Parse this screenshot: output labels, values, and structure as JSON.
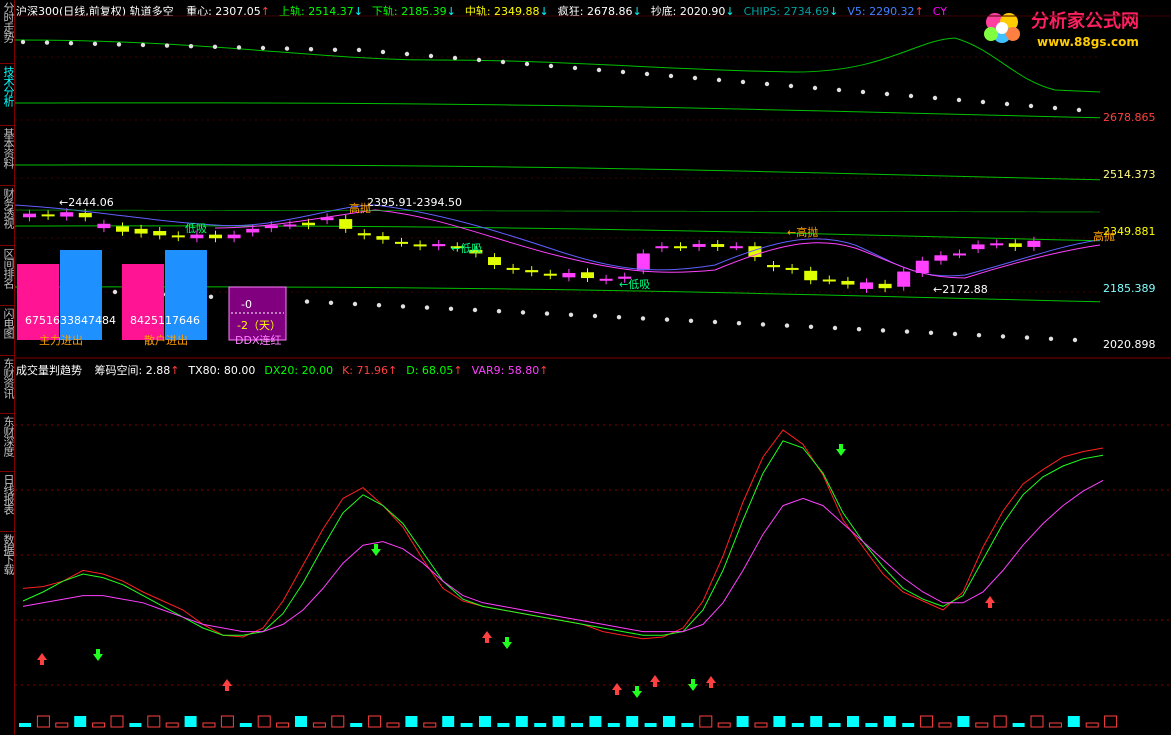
{
  "sidebar": {
    "items": [
      {
        "label": "分时走势",
        "active": false
      },
      {
        "label": "技术分析",
        "active": true
      },
      {
        "label": "基本资料",
        "active": false
      },
      {
        "label": "财务透视",
        "active": false
      },
      {
        "label": "区间排名",
        "active": false
      },
      {
        "label": "闪电图",
        "active": false
      },
      {
        "label": "东财资讯",
        "active": false
      },
      {
        "label": "东财深度",
        "active": false
      },
      {
        "label": "日线报表",
        "active": false
      },
      {
        "label": "数据下载",
        "active": false
      }
    ]
  },
  "header": {
    "title": "沪深300(日线,前复权) 轨道多空",
    "items": [
      {
        "label": "重心: 2307.05",
        "arrow": "↑",
        "color": "#ffffff"
      },
      {
        "label": "上轨: 2514.37",
        "arrow": "↓",
        "color": "#00ff00"
      },
      {
        "label": "下轨: 2185.39",
        "arrow": "↓",
        "color": "#00ff00"
      },
      {
        "label": "中轨: 2349.88",
        "arrow": "↓",
        "color": "#ffff00"
      },
      {
        "label": "疯狂: 2678.86",
        "arrow": "↓",
        "color": "#ffffff"
      },
      {
        "label": "抄底: 2020.90",
        "arrow": "↓",
        "color": "#ffffff"
      },
      {
        "label": "CHIPS: 2734.69",
        "arrow": "↓",
        "color": "#00a0a0"
      },
      {
        "label": "V5: 2290.32",
        "arrow": "↑",
        "color": "#4080ff"
      },
      {
        "label": "CY",
        "arrow": "",
        "color": "#ff00ff"
      }
    ]
  },
  "logo": {
    "text": "分析家公式网",
    "url_text": "www.88gs.com"
  },
  "price_axis": {
    "labels": [
      {
        "text": "2678.865",
        "color": "#ff4040"
      },
      {
        "text": "2514.373",
        "color": "#ffff80"
      },
      {
        "text": "2349.881",
        "color": "#ffff00"
      },
      {
        "text": "2185.389",
        "color": "#80ffff"
      },
      {
        "text": "2020.898",
        "color": "#ffffff"
      }
    ]
  },
  "annotations": {
    "high_price": "←2444.06",
    "range_label": "2395.91-2394.50",
    "low_price": "←2172.88",
    "sell_label_1": "←高抛",
    "sell_label_2": "高抛",
    "sell_label_3": "高抛",
    "buy_label_1": "←低吸",
    "buy_label_2": "←低吸",
    "buy_label_3": "低吸"
  },
  "flow_panels": [
    {
      "value_text": "6751633847484",
      "caption": "主力进出",
      "left_color": "#ff1493",
      "right_color": "#1e90ff"
    },
    {
      "value_text": "8425117646",
      "caption": "散户进出",
      "left_color": "#ff1493",
      "right_color": "#1e90ff"
    }
  ],
  "ddx_panel": {
    "top_value": "-0",
    "bottom_value": "-2（天）",
    "caption": "DDX连红"
  },
  "lower_header": {
    "title": "成交量判趋势",
    "items": [
      {
        "label": "筹码空间: 2.88",
        "arrow": "↑",
        "color": "#ffffff"
      },
      {
        "label": "TX80: 80.00",
        "arrow": "",
        "color": "#ffffff"
      },
      {
        "label": "DX20: 20.00",
        "arrow": "",
        "color": "#00ff00"
      },
      {
        "label": "K: 71.96",
        "arrow": "↑",
        "color": "#ff4040"
      },
      {
        "label": "D: 68.05",
        "arrow": "↑",
        "color": "#00ff00"
      },
      {
        "label": "VAR9: 58.80",
        "arrow": "↑",
        "color": "#ff40ff"
      }
    ]
  },
  "chart_data": {
    "type": "line",
    "candles": [
      {
        "o": 2410,
        "c": 2420
      },
      {
        "o": 2418,
        "c": 2414
      },
      {
        "o": 2412,
        "c": 2424
      },
      {
        "o": 2422,
        "c": 2410
      },
      {
        "o": 2380,
        "c": 2392
      },
      {
        "o": 2385,
        "c": 2370
      },
      {
        "o": 2378,
        "c": 2365
      },
      {
        "o": 2372,
        "c": 2360
      },
      {
        "o": 2360,
        "c": 2355
      },
      {
        "o": 2352,
        "c": 2362
      },
      {
        "o": 2362,
        "c": 2352
      },
      {
        "o": 2352,
        "c": 2362
      },
      {
        "o": 2368,
        "c": 2378
      },
      {
        "o": 2380,
        "c": 2388
      },
      {
        "o": 2388,
        "c": 2390
      },
      {
        "o": 2395,
        "c": 2388
      },
      {
        "o": 2402,
        "c": 2410
      },
      {
        "o": 2405,
        "c": 2378
      },
      {
        "o": 2366,
        "c": 2360
      },
      {
        "o": 2358,
        "c": 2348
      },
      {
        "o": 2342,
        "c": 2340
      },
      {
        "o": 2335,
        "c": 2330
      },
      {
        "o": 2330,
        "c": 2336
      },
      {
        "o": 2330,
        "c": 2326
      },
      {
        "o": 2320,
        "c": 2310
      },
      {
        "o": 2300,
        "c": 2278
      },
      {
        "o": 2270,
        "c": 2265
      },
      {
        "o": 2264,
        "c": 2258
      },
      {
        "o": 2254,
        "c": 2250
      },
      {
        "o": 2244,
        "c": 2256
      },
      {
        "o": 2258,
        "c": 2242
      },
      {
        "o": 2236,
        "c": 2240
      },
      {
        "o": 2240,
        "c": 2246
      },
      {
        "o": 2264,
        "c": 2310
      },
      {
        "o": 2325,
        "c": 2330
      },
      {
        "o": 2330,
        "c": 2328
      },
      {
        "o": 2328,
        "c": 2336
      },
      {
        "o": 2336,
        "c": 2328
      },
      {
        "o": 2330,
        "c": 2330
      },
      {
        "o": 2330,
        "c": 2300
      },
      {
        "o": 2278,
        "c": 2272
      },
      {
        "o": 2270,
        "c": 2265
      },
      {
        "o": 2262,
        "c": 2236
      },
      {
        "o": 2238,
        "c": 2236
      },
      {
        "o": 2234,
        "c": 2224
      },
      {
        "o": 2212,
        "c": 2230
      },
      {
        "o": 2226,
        "c": 2214
      },
      {
        "o": 2218,
        "c": 2260
      },
      {
        "o": 2256,
        "c": 2290
      },
      {
        "o": 2290,
        "c": 2305
      },
      {
        "o": 2308,
        "c": 2310
      },
      {
        "o": 2322,
        "c": 2335
      },
      {
        "o": 2335,
        "c": 2338
      },
      {
        "o": 2338,
        "c": 2328
      },
      {
        "o": 2328,
        "c": 2345
      }
    ],
    "series": [
      {
        "values": [
          62,
          63,
          66,
          72,
          70,
          66,
          60,
          55,
          50,
          42,
          36,
          35,
          40,
          55,
          75,
          95,
          112,
          118,
          108,
          96,
          78,
          62,
          55,
          52,
          50,
          48,
          46,
          44,
          42,
          38,
          36,
          34,
          35,
          40,
          55,
          80,
          110,
          135,
          150,
          142,
          125,
          100,
          85,
          70,
          60,
          55,
          50,
          60,
          85,
          105,
          120,
          128,
          135,
          138,
          140
        ]
      },
      {
        "values": [
          55,
          60,
          66,
          70,
          68,
          64,
          58,
          52,
          46,
          40,
          36,
          36,
          38,
          48,
          65,
          85,
          104,
          114,
          108,
          98,
          82,
          66,
          56,
          52,
          50,
          48,
          46,
          44,
          42,
          40,
          38,
          36,
          36,
          38,
          50,
          72,
          100,
          126,
          144,
          140,
          126,
          104,
          88,
          74,
          62,
          56,
          52,
          58,
          78,
          98,
          114,
          124,
          130,
          134,
          136
        ]
      },
      {
        "values": [
          52,
          54,
          56,
          58,
          58,
          56,
          54,
          50,
          46,
          42,
          40,
          38,
          38,
          42,
          50,
          62,
          76,
          86,
          88,
          84,
          76,
          66,
          58,
          54,
          52,
          50,
          48,
          46,
          44,
          42,
          40,
          38,
          38,
          38,
          42,
          54,
          72,
          92,
          108,
          112,
          108,
          98,
          88,
          78,
          68,
          60,
          54,
          54,
          60,
          72,
          86,
          98,
          108,
          116,
          122
        ]
      }
    ]
  }
}
